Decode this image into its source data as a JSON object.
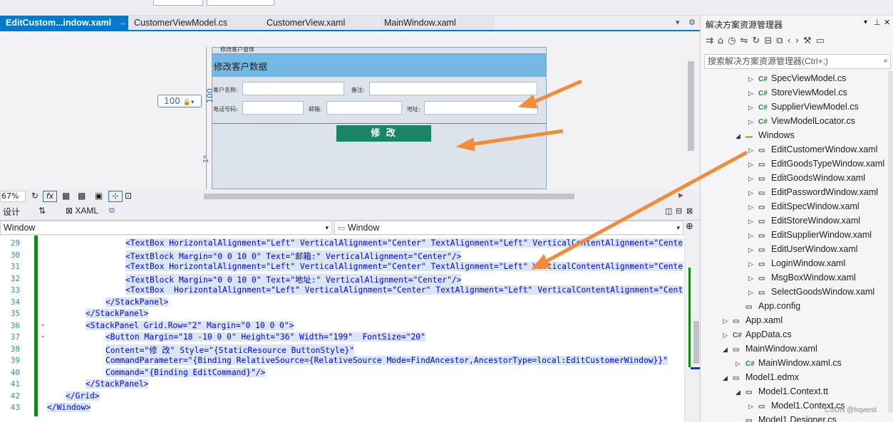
{
  "tabs": [
    {
      "label": "EditCustom...indow.xaml",
      "pin": "⇔",
      "close": "✕"
    },
    {
      "label": "CustomerViewModel.cs"
    },
    {
      "label": "CustomerView.xaml"
    },
    {
      "label": "MainWindow.xaml"
    }
  ],
  "designer": {
    "window_title": "修改客户窗体",
    "header": "修改客户数据",
    "fields": [
      {
        "label": "客户名称:"
      },
      {
        "label": "备注:"
      },
      {
        "label": "电话号码:"
      },
      {
        "label": "邮箱:"
      },
      {
        "label": "地址:"
      }
    ],
    "button": "修 改",
    "width_value": "100",
    "height_value": "100",
    "star_value": "1*",
    "zoom": "67%"
  },
  "split": {
    "design_tab": "设计",
    "swap": "⇅",
    "xaml_tab": "XAML"
  },
  "combos": {
    "left": "Window",
    "right": "Window"
  },
  "code_lines": [
    {
      "n": "29",
      "text": "<TextBox HorizontalAlignment=\"Left\" VerticalAlignment=\"Center\" TextAlignment=\"Left\" VerticalContentAlignment=\"Center\""
    },
    {
      "n": "30",
      "text": "<TextBlock Margin=\"0 0 10 0\" Text=\"邮箱:\" VerticalAlignment=\"Center\"/>"
    },
    {
      "n": "31",
      "text": "<TextBox HorizontalAlignment=\"Left\" VerticalAlignment=\"Center\" TextAlignment=\"Left\" VerticalContentAlignment=\"Center\""
    },
    {
      "n": "32",
      "text": "<TextBlock Margin=\"0 0 10 0\" Text=\"地址:\" VerticalAlignment=\"Center\"/>"
    },
    {
      "n": "33",
      "text": "<TextBox  HorizontalAlignment=\"Left\" VerticalAlignment=\"Center\" TextAlignment=\"Left\" VerticalContentAlignment=\"Center"
    },
    {
      "n": "34",
      "text": "</StackPanel>"
    },
    {
      "n": "35",
      "text": "</StackPanel>"
    },
    {
      "n": "36",
      "text": "<StackPanel Grid.Row=\"2\" Margin=\"0 10 0 0\">"
    },
    {
      "n": "37",
      "text": "<Button Margin=\"18 -10 0 0\" Height=\"36\" Width=\"199\"  FontSize=\"20\""
    },
    {
      "n": "38",
      "text": "Content=\"修 改\" Style=\"{StaticResource ButtonStyle}\""
    },
    {
      "n": "39",
      "text": "CommandParameter=\"{Binding RelativeSource={RelativeSource Mode=FindAncestor,AncestorType=local:EditCustomerWindow}}\""
    },
    {
      "n": "40",
      "text": "Command=\"{Binding EditCommand}\"/>"
    },
    {
      "n": "41",
      "text": "</StackPanel>"
    },
    {
      "n": "42",
      "text": "</Grid>"
    },
    {
      "n": "43",
      "text": "</Window>"
    }
  ],
  "solution": {
    "title": "解决方案资源管理器",
    "search_placeholder": "搜索解决方案资源管理器(Ctrl+;)",
    "items": [
      {
        "label": "SpecViewModel.cs",
        "icon": "C#",
        "indent": 2,
        "expand": "▷"
      },
      {
        "label": "StoreViewModel.cs",
        "icon": "C#",
        "indent": 2,
        "expand": "▷"
      },
      {
        "label": "SupplierViewModel.cs",
        "icon": "C#",
        "indent": 2,
        "expand": "▷"
      },
      {
        "label": "ViewModelLocator.cs",
        "icon": "C#",
        "indent": 2,
        "expand": "▷"
      },
      {
        "label": "Windows",
        "icon": "▬",
        "indent": 1,
        "expand": "◢"
      },
      {
        "label": "EditCustomerWindow.xaml",
        "icon": "▭",
        "indent": 2,
        "expand": "▷"
      },
      {
        "label": "EditGoodsTypeWindow.xaml",
        "icon": "▭",
        "indent": 2,
        "expand": "▷"
      },
      {
        "label": "EditGoodsWindow.xaml",
        "icon": "▭",
        "indent": 2,
        "expand": "▷"
      },
      {
        "label": "EditPasswordWindow.xaml",
        "icon": "▭",
        "indent": 2,
        "expand": "▷"
      },
      {
        "label": "EditSpecWindow.xaml",
        "icon": "▭",
        "indent": 2,
        "expand": "▷"
      },
      {
        "label": "EditStoreWindow.xaml",
        "icon": "▭",
        "indent": 2,
        "expand": "▷"
      },
      {
        "label": "EditSupplierWindow.xaml",
        "icon": "▭",
        "indent": 2,
        "expand": "▷"
      },
      {
        "label": "EditUserWindow.xaml",
        "icon": "▭",
        "indent": 2,
        "expand": "▷"
      },
      {
        "label": "LoginWindow.xaml",
        "icon": "▭",
        "indent": 2,
        "expand": "▷"
      },
      {
        "label": "MsgBoxWindow.xaml",
        "icon": "▭",
        "indent": 2,
        "expand": "▷"
      },
      {
        "label": "SelectGoodsWindow.xaml",
        "icon": "▭",
        "indent": 2,
        "expand": "▷"
      },
      {
        "label": "App.config",
        "icon": "▭",
        "indent": 1,
        "expand": ""
      },
      {
        "label": "App.xaml",
        "icon": "▭",
        "indent": 0,
        "expand": "▷"
      },
      {
        "label": "AppData.cs",
        "icon": "C#",
        "indent": 0,
        "expand": "▷"
      },
      {
        "label": "MainWindow.xaml",
        "icon": "▭",
        "indent": 0,
        "expand": "◢"
      },
      {
        "label": "MainWindow.xaml.cs",
        "icon": "C#",
        "indent": 1,
        "expand": "▷"
      },
      {
        "label": "Model1.edmx",
        "icon": "▭",
        "indent": 0,
        "expand": "◢"
      },
      {
        "label": "Model1.Context.tt",
        "icon": "▭",
        "indent": 1,
        "expand": "◢"
      },
      {
        "label": "Model1.Context.cs",
        "icon": "▭",
        "indent": 2,
        "expand": "▷"
      },
      {
        "label": "Model1.Designer.cs",
        "icon": "▭",
        "indent": 1,
        "expand": ""
      }
    ]
  },
  "watermark": "CSDN @hqwest",
  "colors": {
    "accent": "#007acc",
    "button": "#1a8466",
    "header": "#74b9e4",
    "arrow": "#f28c38"
  }
}
